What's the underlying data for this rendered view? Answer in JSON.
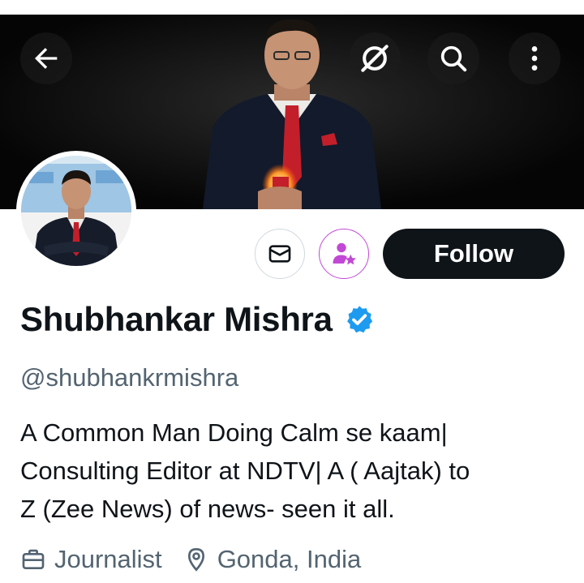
{
  "header": {
    "back_icon": "back-arrow-icon",
    "grok_icon": "grok-icon",
    "search_icon": "search-icon",
    "more_icon": "more-vertical-icon"
  },
  "actions": {
    "message_icon": "envelope-icon",
    "subscribe_icon": "subscribe-person-star-icon",
    "follow_label": "Follow"
  },
  "profile": {
    "display_name": "Shubhankar Mishra",
    "verified": true,
    "handle": "@shubhankrmishra",
    "bio_lines": [
      "A Common Man Doing Calm se kaam|",
      "Consulting Editor at NDTV| A ( Aajtak) to",
      "Z (Zee News) of news- seen it all."
    ],
    "profession": "Journalist",
    "location": "Gonda, India"
  },
  "colors": {
    "follow_bg": "#0f1419",
    "verified_blue": "#1d9bf0",
    "secondary_text": "#536471",
    "subscribe_accent": "#c248d6"
  }
}
